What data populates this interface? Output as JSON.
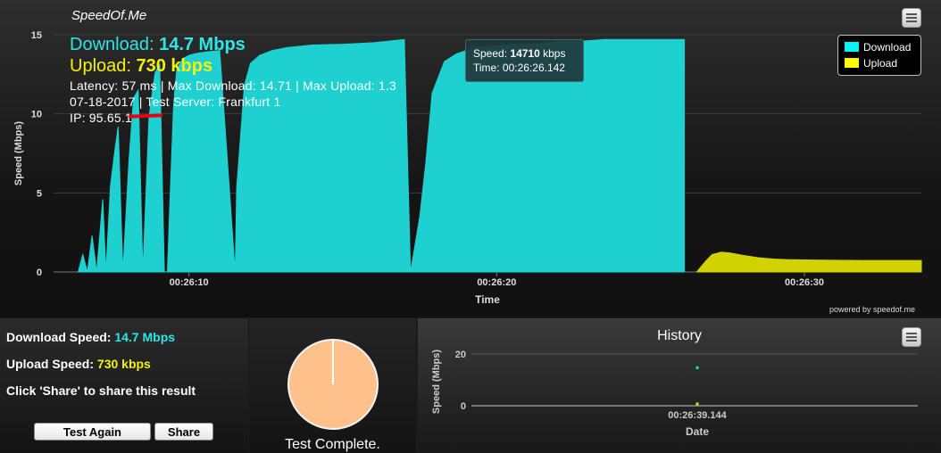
{
  "app": {
    "brand": "SpeedOf.Me"
  },
  "overlay": {
    "download_label": "Download:",
    "download_value": "14.7 Mbps",
    "upload_label": "Upload:",
    "upload_value": "730 kbps",
    "stats_line": "Latency: 57 ms | Max Download: 14.71 | Max Upload: 1.3",
    "date_line": "07-18-2017 | Test Server: Frankfurt 1",
    "ip_line": "IP: 95.65.1"
  },
  "legend": {
    "download": "Download",
    "upload": "Upload"
  },
  "tooltip": {
    "speed_label": "Speed:",
    "speed_value": "14710",
    "speed_unit": "kbps",
    "time_label": "Time:",
    "time_value": "00:26:26.142"
  },
  "powered": "powered by speedof.me",
  "colors": {
    "download": "#1ed0d0",
    "upload": "#d2d200",
    "download_text": "#2ee6e6",
    "upload_text": "#f2f20d",
    "pie": "#ffc18c"
  },
  "chart_data": [
    {
      "type": "area",
      "ylabel": "Speed (Mbps)",
      "xlabel": "Time",
      "ylim": [
        0,
        15
      ],
      "xlim": [
        5.6,
        33.8
      ],
      "x_unit": "seconds after 00:26:00",
      "yticks": [
        0,
        5,
        10,
        15
      ],
      "xtick_labels": [
        "00:26:10",
        "00:26:20",
        "00:26:30"
      ],
      "xtick_values": [
        10,
        20,
        30
      ],
      "grid": true,
      "legend": "top-right",
      "series": [
        {
          "name": "Download",
          "color": "#1ed0d0",
          "x": [
            6.4,
            6.55,
            6.7,
            6.85,
            7.0,
            7.2,
            7.3,
            7.45,
            7.6,
            7.7,
            7.85,
            8.05,
            8.2,
            8.35,
            8.5,
            8.7,
            8.9,
            9.05,
            9.2,
            9.3,
            9.4,
            9.5,
            9.6,
            9.8,
            10.0,
            10.2,
            10.5,
            11.0,
            11.5,
            11.55,
            11.8,
            12.0,
            12.3,
            12.7,
            13.2,
            14.0,
            15.0,
            16.0,
            17.0,
            17.2,
            17.5,
            17.7,
            17.9,
            18.3,
            18.7,
            19.3,
            20.5,
            21.5,
            22.0,
            22.8,
            23.5,
            26.1,
            26.1
          ],
          "y": [
            0,
            1.1,
            0,
            2.3,
            0,
            4.6,
            0,
            5.5,
            7.8,
            9.2,
            0,
            7.0,
            11.0,
            11.5,
            0,
            9.8,
            12.6,
            13.1,
            0,
            0,
            5.5,
            10.5,
            12.8,
            13.5,
            13.7,
            13.8,
            13.9,
            14.0,
            0,
            5.3,
            11.8,
            13.2,
            13.7,
            14.0,
            14.2,
            14.35,
            14.4,
            14.5,
            14.7,
            0,
            3.5,
            7.0,
            11.3,
            13.3,
            13.8,
            14.2,
            14.4,
            14.45,
            14.6,
            14.6,
            14.7,
            14.7,
            0
          ]
        },
        {
          "name": "Upload",
          "color": "#d2d200",
          "x": [
            26.5,
            26.8,
            27.0,
            27.3,
            27.6,
            28.0,
            28.5,
            29.0,
            29.5,
            30.0,
            31.0,
            32.0,
            33.8
          ],
          "y": [
            0,
            0.7,
            1.1,
            1.25,
            1.2,
            1.05,
            0.9,
            0.82,
            0.78,
            0.76,
            0.74,
            0.73,
            0.73
          ]
        }
      ]
    },
    {
      "type": "scatter",
      "title": "History",
      "ylabel": "Speed (Mbps)",
      "xlabel": "Date",
      "yticks": [
        0,
        20
      ],
      "ylim": [
        0,
        20
      ],
      "xtick_labels": [
        "00:26:39.144"
      ],
      "series": [
        {
          "name": "Download",
          "color": "#1ed0d0",
          "x": [
            "00:26:39.144"
          ],
          "y": [
            14.7
          ]
        },
        {
          "name": "Upload",
          "color": "#d2d200",
          "x": [
            "00:26:39.144"
          ],
          "y": [
            0.73
          ]
        }
      ]
    }
  ],
  "summary": {
    "download_label": "Download Speed:",
    "download_value": "14.7 Mbps",
    "upload_label": "Upload Speed:",
    "upload_value": "730 kbps",
    "share_hint": "Click 'Share' to share this result"
  },
  "buttons": {
    "test_again": "Test Again",
    "share": "Share"
  },
  "status": {
    "complete": "Test Complete.",
    "progress": 1.0
  },
  "history": {
    "title": "History"
  }
}
